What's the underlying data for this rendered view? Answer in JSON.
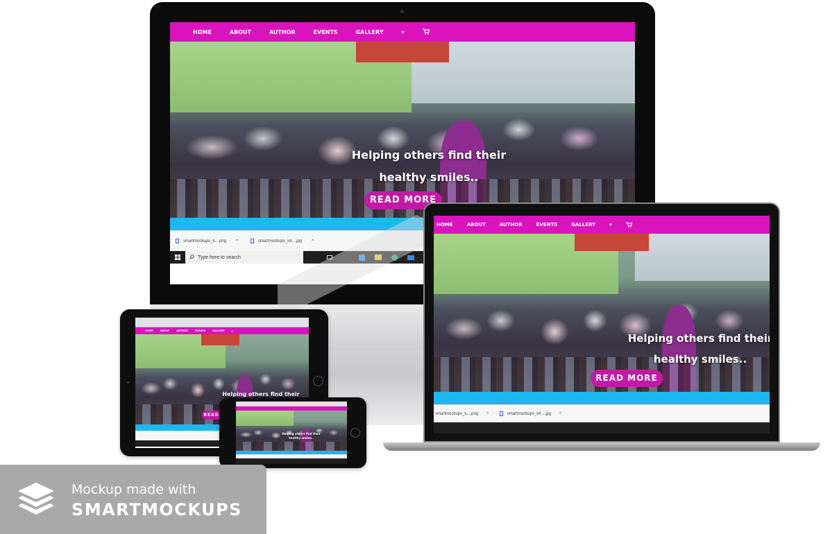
{
  "site": {
    "nav": [
      "HOME",
      "ABOUT",
      "AUTHOR",
      "EVENTS",
      "GALLERY"
    ],
    "nav_caret": "▾",
    "cart_icon": "cart-icon",
    "hero_line1": "Helping others find their",
    "hero_line2": "healthy smiles..",
    "cta": "READ MORE",
    "brand_color": "#d914bd",
    "accent_color": "#1cb8ef"
  },
  "monitor_downloads": [
    {
      "name": "smartmockups_k....png",
      "chevron": "^"
    },
    {
      "name": "smartmockups_k4....jpg",
      "chevron": "^"
    }
  ],
  "laptop_downloads": [
    {
      "name": "smartmockups_k....png",
      "chevron": "^"
    },
    {
      "name": "smartmockups_k4....jpg",
      "chevron": "^"
    }
  ],
  "taskbar": {
    "search_placeholder": "Type here to search"
  },
  "watermark": {
    "line1": "Mockup made with",
    "line2": "SMARTMOCKUPS"
  }
}
